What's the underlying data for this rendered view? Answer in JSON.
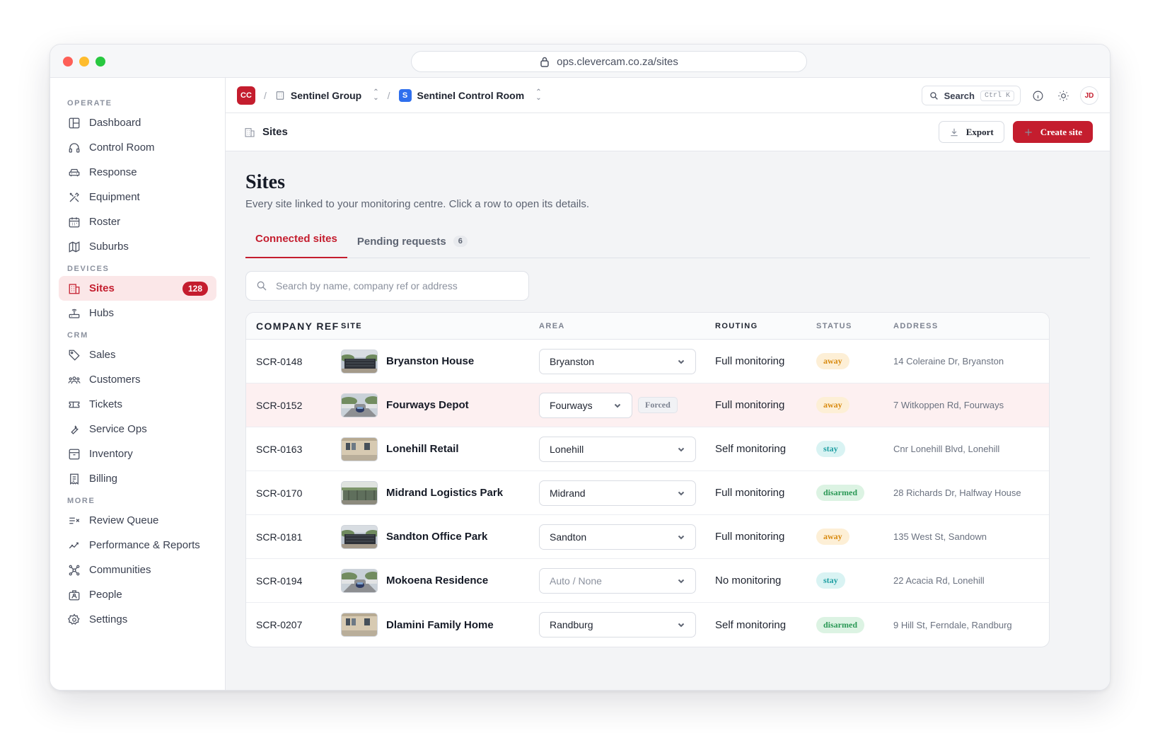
{
  "browser": {
    "url": "ops.clevercam.co.za/sites"
  },
  "sidebar": {
    "sections": [
      {
        "label": "OPERATE",
        "items": [
          {
            "label": "Dashboard",
            "icon": "dashboard-icon"
          },
          {
            "label": "Control Room",
            "icon": "headset-icon"
          },
          {
            "label": "Response",
            "icon": "car-icon"
          },
          {
            "label": "Equipment",
            "icon": "tools-icon"
          },
          {
            "label": "Roster",
            "icon": "calendar-icon"
          },
          {
            "label": "Suburbs",
            "icon": "map-icon"
          }
        ]
      },
      {
        "label": "DEVICES",
        "items": [
          {
            "label": "Sites",
            "icon": "building-icon",
            "active": true,
            "badge": "128"
          },
          {
            "label": "Hubs",
            "icon": "router-icon"
          }
        ]
      },
      {
        "label": "CRM",
        "items": [
          {
            "label": "Sales",
            "icon": "tag-icon"
          },
          {
            "label": "Customers",
            "icon": "users-icon"
          },
          {
            "label": "Tickets",
            "icon": "ticket-icon"
          },
          {
            "label": "Service Ops",
            "icon": "wrench-icon"
          },
          {
            "label": "Inventory",
            "icon": "archive-icon"
          },
          {
            "label": "Billing",
            "icon": "receipt-icon"
          }
        ]
      },
      {
        "label": "MORE",
        "items": [
          {
            "label": "Review Queue",
            "icon": "list-check-icon"
          },
          {
            "label": "Performance & Reports",
            "icon": "trend-icon"
          },
          {
            "label": "Communities",
            "icon": "network-icon"
          },
          {
            "label": "People",
            "icon": "id-badge-icon"
          },
          {
            "label": "Settings",
            "icon": "gear-icon"
          }
        ]
      }
    ]
  },
  "topbar": {
    "logo": "CC",
    "org": "Sentinel Group",
    "workspace_badge": "S",
    "workspace": "Sentinel Control Room",
    "search_label": "Search",
    "search_shortcut": "Ctrl K",
    "avatar": "JD"
  },
  "pagebar": {
    "title": "Sites",
    "export_label": "Export",
    "create_label": "Create site"
  },
  "page": {
    "heading": "Sites",
    "subtitle": "Every site linked to your monitoring centre. Click a row to open its details.",
    "tabs": [
      {
        "label": "Connected sites",
        "active": true
      },
      {
        "label": "Pending requests",
        "count": "6"
      }
    ],
    "search_placeholder": "Search by name, company ref or address"
  },
  "table": {
    "columns": [
      "COMPANY REF",
      "SITE",
      "AREA",
      "ROUTING",
      "STATUS",
      "ADDRESS"
    ],
    "rows": [
      {
        "ref": "SCR-0148",
        "site": "Bryanston House",
        "thumb": "gate",
        "area": "Bryanston",
        "routing": "Full monitoring",
        "status": "away",
        "address": "14 Coleraine Dr, Bryanston"
      },
      {
        "ref": "SCR-0152",
        "site": "Fourways Depot",
        "thumb": "driveway",
        "area": "Fourways",
        "forced": "Forced",
        "routing": "Full monitoring",
        "status": "away",
        "address": "7 Witkoppen Rd, Fourways",
        "highlight": true
      },
      {
        "ref": "SCR-0163",
        "site": "Lonehill Retail",
        "thumb": "wall",
        "area": "Lonehill",
        "routing": "Self monitoring",
        "status": "stay",
        "address": "Cnr Lonehill Blvd, Lonehill"
      },
      {
        "ref": "SCR-0170",
        "site": "Midrand Logistics Park",
        "thumb": "fence",
        "area": "Midrand",
        "routing": "Full monitoring",
        "status": "disarmed",
        "address": "28 Richards Dr, Halfway House"
      },
      {
        "ref": "SCR-0181",
        "site": "Sandton Office Park",
        "thumb": "gate",
        "area": "Sandton",
        "routing": "Full monitoring",
        "status": "away",
        "address": "135 West St, Sandown"
      },
      {
        "ref": "SCR-0194",
        "site": "Mokoena Residence",
        "thumb": "driveway",
        "area": "Auto / None",
        "placeholder": true,
        "routing": "No monitoring",
        "status": "stay",
        "address": "22 Acacia Rd, Lonehill"
      },
      {
        "ref": "SCR-0207",
        "site": "Dlamini Family Home",
        "thumb": "wall",
        "area": "Randburg",
        "routing": "Self monitoring",
        "status": "disarmed",
        "address": "9 Hill St, Ferndale, Randburg"
      }
    ]
  },
  "colors": {
    "accent": "#c41d2e",
    "away": "#d88a0f",
    "stay": "#1f9fa3",
    "disarmed": "#2a9855"
  }
}
